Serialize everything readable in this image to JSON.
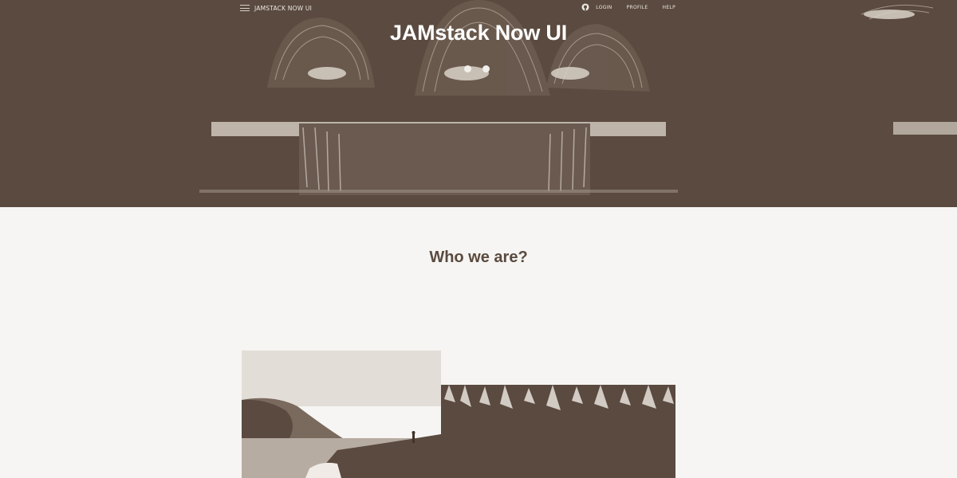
{
  "navbar": {
    "brand": "JAMSTACK NOW UI",
    "links": [
      "LOGIN",
      "PROFILE",
      "HELP"
    ],
    "icons": [
      "twitter-icon",
      "github-icon"
    ]
  },
  "hero": {
    "title": "JAMstack Now UI",
    "dots": 2
  },
  "section": {
    "title": "Who we are?"
  },
  "colors": {
    "accent": "#5a4a3f",
    "background": "#f6f5f3",
    "text_light": "#ffffff"
  }
}
